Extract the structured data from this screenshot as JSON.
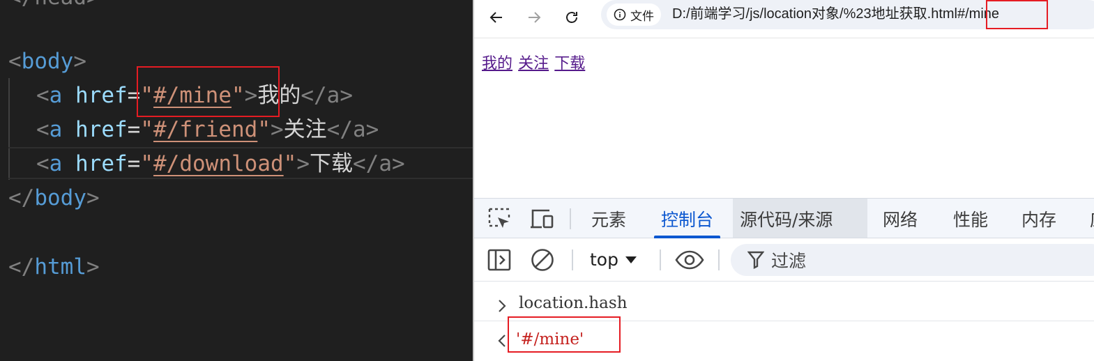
{
  "editor": {
    "cut_line": "</head>",
    "lines": {
      "body_open": {
        "lt": "<",
        "tag": "body",
        "gt": ">"
      },
      "a1": {
        "lt": "<",
        "tag": "a",
        "attr": "href",
        "eq": "=",
        "q1": "\"",
        "href": "#/mine",
        "q2": "\"",
        "gt": ">",
        "text": "我的",
        "close": "</a>"
      },
      "a2": {
        "lt": "<",
        "tag": "a",
        "attr": "href",
        "eq": "=",
        "q1": "\"",
        "href": "#/friend",
        "q2": "\"",
        "gt": ">",
        "text": "关注",
        "close": "</a>"
      },
      "a3": {
        "lt": "<",
        "tag": "a",
        "attr": "href",
        "eq": "=",
        "q1": "\"",
        "href": "#/download",
        "q2": "\"",
        "gt": ">",
        "text": "下载",
        "close": "</a>"
      },
      "body_close": {
        "lt": "</",
        "tag": "body",
        "gt": ">"
      },
      "html_close": {
        "lt": "</",
        "tag": "html",
        "gt": ">"
      }
    }
  },
  "browser": {
    "site_chip": "文件",
    "url_main": "D:/前端学习/js/location对象/%23地址获取.html",
    "url_hash": "#/mine",
    "page_links": [
      "我的",
      "关注",
      "下载"
    ]
  },
  "devtools": {
    "tabs": [
      "元素",
      "控制台",
      "源代码/来源",
      "网络",
      "性能",
      "内存",
      "应"
    ],
    "active_tab": "控制台",
    "context": "top",
    "filter": "过滤",
    "console_input": "location.hash",
    "console_output": "'#/mine'"
  },
  "colors": {
    "accent": "#0b57d0",
    "highlight_box": "#e51c23",
    "console_string": "#c5221f"
  }
}
